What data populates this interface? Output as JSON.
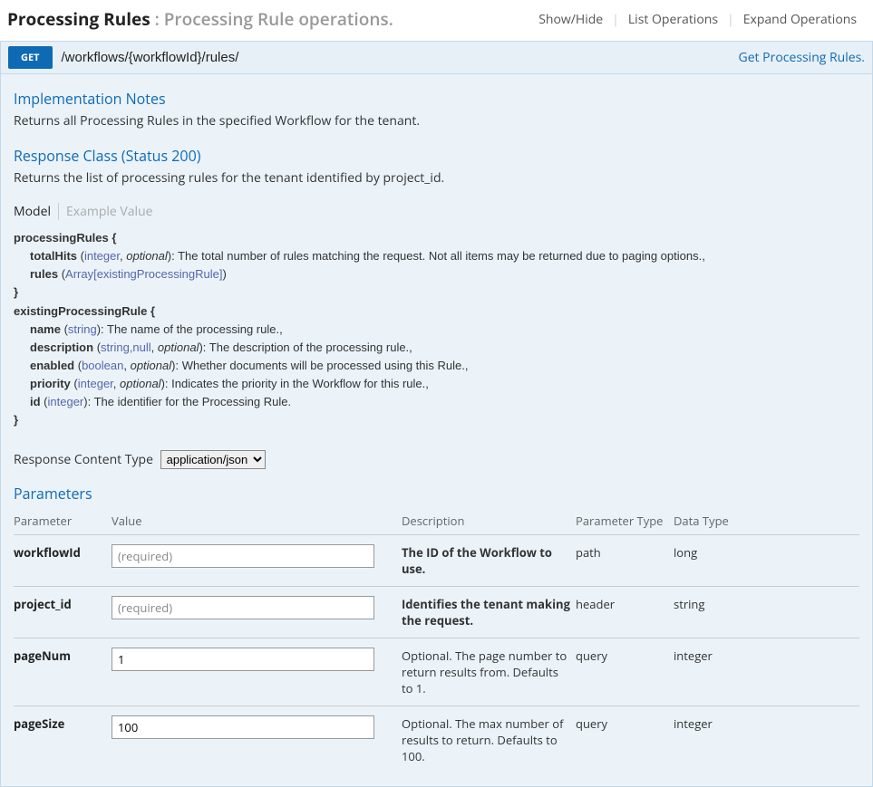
{
  "header": {
    "title": "Processing Rules",
    "subtitle": " : Processing Rule operations.",
    "actions": {
      "showHide": "Show/Hide",
      "listOps": "List Operations",
      "expandOps": "Expand Operations"
    }
  },
  "operation": {
    "method": "GET",
    "path": "/workflows/{workflowId}/rules/",
    "summary": "Get Processing Rules."
  },
  "implNotes": {
    "heading": "Implementation Notes",
    "text": "Returns all Processing Rules in the specified Workflow for the tenant."
  },
  "responseClass": {
    "heading": "Response Class (Status 200)",
    "text": "Returns the list of processing rules for the tenant identified by project_id."
  },
  "tabs": {
    "model": "Model",
    "example": "Example Value"
  },
  "model": {
    "l1": "processingRules {",
    "totalHits_name": "totalHits",
    "totalHits_type": "integer",
    "totalHits_opt": "optional",
    "totalHits_desc": "): The total number of rules matching the request. Not all items may be returned due to paging options.,",
    "rules_name": "rules",
    "rules_type": "Array[existingProcessingRule]",
    "close1": "}",
    "l2": "existingProcessingRule {",
    "name_name": "name",
    "name_type": "string",
    "name_desc": "): The name of the processing rule.,",
    "desc_name": "description",
    "desc_type": "string,null",
    "desc_opt": "optional",
    "desc_desc": "): The description of the processing rule.,",
    "enabled_name": "enabled",
    "enabled_type": "boolean",
    "enabled_opt": "optional",
    "enabled_desc": "): Whether documents will be processed using this Rule.,",
    "priority_name": "priority",
    "priority_type": "integer",
    "priority_opt": "optional",
    "priority_desc": "): Indicates the priority in the Workflow for this rule.,",
    "id_name": "id",
    "id_type": "integer",
    "id_desc": "): The identifier for the Processing Rule.",
    "close2": "}"
  },
  "contentType": {
    "label": "Response Content Type",
    "value": "application/json"
  },
  "parameters": {
    "heading": "Parameters",
    "cols": {
      "parameter": "Parameter",
      "value": "Value",
      "description": "Description",
      "ptype": "Parameter Type",
      "dtype": "Data Type"
    },
    "rows": [
      {
        "name": "workflowId",
        "placeholder": "(required)",
        "value": "",
        "description": "The ID of the Workflow to use.",
        "descBold": true,
        "ptype": "path",
        "dtype": "long"
      },
      {
        "name": "project_id",
        "placeholder": "(required)",
        "value": "",
        "description": "Identifies the tenant making the request.",
        "descBold": true,
        "ptype": "header",
        "dtype": "string"
      },
      {
        "name": "pageNum",
        "placeholder": "",
        "value": "1",
        "description": "Optional. The page number to return results from. Defaults to 1.",
        "descBold": false,
        "ptype": "query",
        "dtype": "integer"
      },
      {
        "name": "pageSize",
        "placeholder": "",
        "value": "100",
        "description": "Optional. The max number of results to return. Defaults to 100.",
        "descBold": false,
        "ptype": "query",
        "dtype": "integer"
      }
    ]
  }
}
